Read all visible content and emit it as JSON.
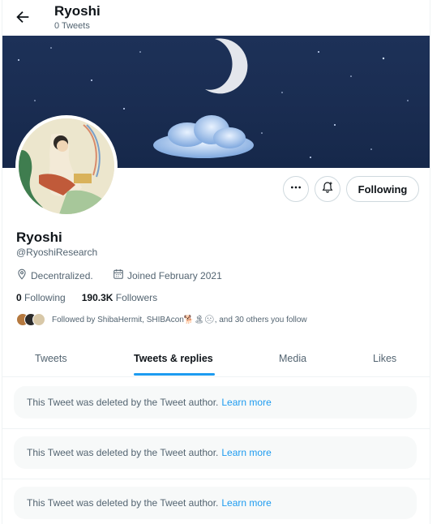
{
  "header": {
    "title": "Ryoshi",
    "tweet_count": "0 Tweets"
  },
  "profile": {
    "name": "Ryoshi",
    "handle": "@RyoshiResearch",
    "location": "Decentralized.",
    "joined": "Joined February 2021",
    "following_count": "0",
    "following_label": "Following",
    "followers_count": "190.3K",
    "followers_label": "Followers",
    "followed_by": "Followed by ShibaHermit, SHIBAcon🐕🏝☹, and 30 others you follow"
  },
  "actions": {
    "follow_label": "Following"
  },
  "tabs": [
    {
      "label": "Tweets"
    },
    {
      "label": "Tweets & replies"
    },
    {
      "label": "Media"
    },
    {
      "label": "Likes"
    }
  ],
  "tweets": [
    {
      "text": "This Tweet was deleted by the Tweet author.",
      "link": "Learn more"
    },
    {
      "text": "This Tweet was deleted by the Tweet author.",
      "link": "Learn more"
    },
    {
      "text": "This Tweet was deleted by the Tweet author.",
      "link": "Learn more"
    }
  ],
  "icons": [
    "back-arrow-icon",
    "more-icon",
    "notification-bell-icon",
    "location-icon",
    "calendar-icon"
  ],
  "colors": {
    "accent": "#1d9bf0",
    "banner": "#1d3158",
    "text": "#0f1419",
    "muted": "#536471"
  }
}
